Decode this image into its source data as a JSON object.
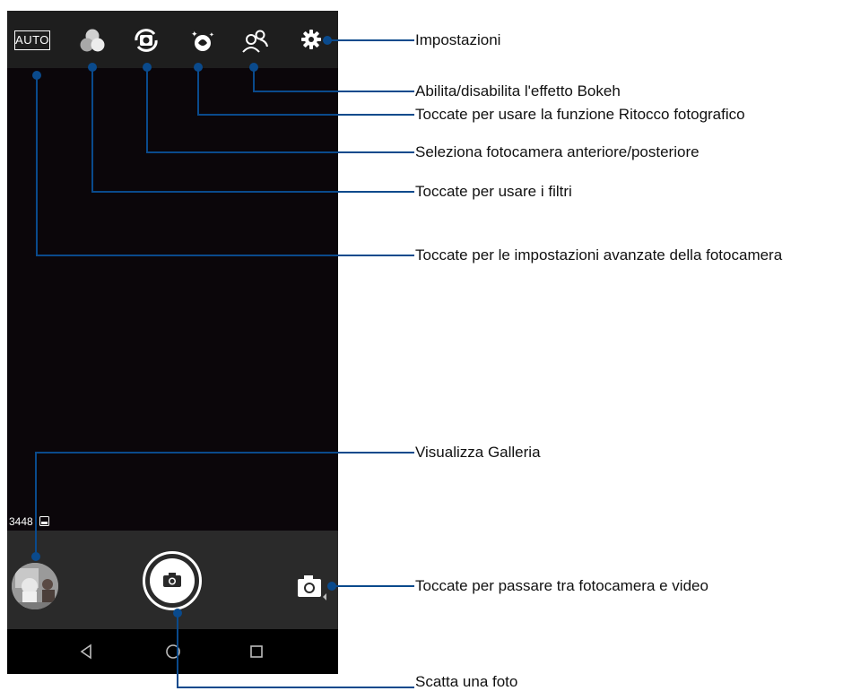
{
  "topbar": {
    "auto_label": "AUTO",
    "icons": [
      "filter-icon",
      "camera-switch-icon",
      "beautification-icon",
      "bokeh-icon",
      "gear-icon"
    ]
  },
  "viewfinder": {
    "photo_count": "3448",
    "count_icon": "gallery-small-icon"
  },
  "bottom": {
    "gallery_thumbnail": "gallery-thumbnail",
    "shutter_icon": "camera-icon",
    "mode_icon": "camera-video-switch-icon"
  },
  "navbar": {
    "icons": [
      "back-icon",
      "home-icon",
      "recents-icon"
    ]
  },
  "callouts": {
    "settings": "Impostazioni",
    "bokeh": "Abilita/disabilita l'effetto Bokeh",
    "beautification": "Toccate per usare la funzione Ritocco fotografico",
    "switch_camera": "Seleziona fotocamera anteriore/posteriore",
    "filters": "Toccate per usare i filtri",
    "advanced": "Toccate per le impostazioni avanzate della fotocamera",
    "gallery": "Visualizza Galleria",
    "mode": "Toccate per passare tra fotocamera e video",
    "shutter": "Scatta una foto"
  },
  "colors": {
    "callout_line": "#0a4a8c",
    "topbar_bg": "#1e1e1e",
    "viewfinder_bg": "#0b060a",
    "bottom_bg": "#2a2a2a"
  }
}
